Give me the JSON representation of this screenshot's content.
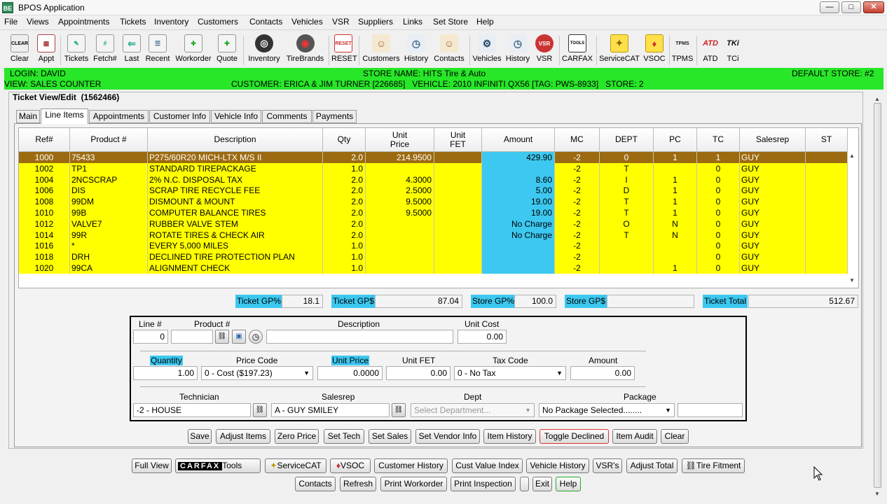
{
  "window": {
    "title": "BPOS Application",
    "icon": "BE",
    "controls": [
      "—",
      "□",
      "✕"
    ]
  },
  "menu": [
    "File",
    "Views",
    "Appointments",
    "Tickets",
    "Inventory",
    "Customers",
    "Contacts",
    "Vehicles",
    "VSR",
    "Suppliers",
    "Links",
    "Set Store",
    "Help"
  ],
  "toolbar": [
    {
      "label": "Clear",
      "icon": "CLEAR"
    },
    {
      "label": "Appt",
      "icon": "▦"
    },
    {
      "label": "Tickets",
      "icon": "✎"
    },
    {
      "label": "Fetch#",
      "icon": "#"
    },
    {
      "label": "Last",
      "icon": "⇐"
    },
    {
      "label": "Recent",
      "icon": "☰"
    },
    {
      "label": "Workorder",
      "icon": "✚"
    },
    {
      "label": "Quote",
      "icon": "✚"
    },
    {
      "label": "Inventory",
      "icon": "◎"
    },
    {
      "label": "TireBrands",
      "icon": "◉"
    },
    {
      "label": "RESET",
      "icon": "RESET"
    },
    {
      "label": "Customers",
      "icon": "☺"
    },
    {
      "label": "History",
      "icon": "◷"
    },
    {
      "label": "Contacts",
      "icon": "☺"
    },
    {
      "label": "Vehicles",
      "icon": "⚙"
    },
    {
      "label": "History",
      "icon": "◷"
    },
    {
      "label": "VSR",
      "icon": "VSR"
    },
    {
      "label": "CARFAX",
      "icon": "TOOLS"
    },
    {
      "label": "ServiceCAT",
      "icon": "✦"
    },
    {
      "label": "VSOC",
      "icon": "♦"
    },
    {
      "label": "TPMS",
      "icon": "TPMS"
    },
    {
      "label": "ATD",
      "icon": "ATD"
    },
    {
      "label": "TCi",
      "icon": "TKi"
    }
  ],
  "info": {
    "login": "LOGIN: DAVID",
    "view": "VIEW: SALES COUNTER",
    "store_name": "STORE NAME: HITS Tire & Auto",
    "customer_line": "CUSTOMER: ERICA & JIM TURNER [226685]   VEHICLE: 2010 INFINITI QX56 [TAG: PWS-8933]   STORE: 2",
    "default_store": "DEFAULT STORE: #2"
  },
  "panel": {
    "title": "Ticket View/Edit  (1562466)"
  },
  "tabs": [
    "Main",
    "Line Items",
    "Appointments",
    "Customer Info",
    "Vehicle Info",
    "Comments",
    "Payments"
  ],
  "grid": {
    "headers": [
      "Ref#",
      "Product #",
      "Description",
      "Qty",
      "Unit\nPrice",
      "Unit\nFET",
      "Amount",
      "MC",
      "DEPT",
      "PC",
      "TC",
      "Salesrep",
      "ST"
    ],
    "rows": [
      [
        "1000",
        "75433",
        "P275/60R20  MICH-LTX M/S II",
        "2.0",
        "214.9500",
        "",
        "429.90",
        "-2",
        "0",
        "1",
        "1",
        "GUY",
        ""
      ],
      [
        "1002",
        "TP1",
        "STANDARD TIREPACKAGE",
        "1.0",
        "",
        "",
        "",
        "-2",
        "T",
        "",
        "0",
        "GUY",
        ""
      ],
      [
        "1004",
        "2NCSCRAP",
        "2% N.C. DISPOSAL TAX",
        "2.0",
        "4.3000",
        "",
        "8.60",
        "-2",
        "I",
        "1",
        "0",
        "GUY",
        ""
      ],
      [
        "1006",
        "DIS",
        "SCRAP TIRE RECYCLE FEE",
        "2.0",
        "2.5000",
        "",
        "5.00",
        "-2",
        "D",
        "1",
        "0",
        "GUY",
        ""
      ],
      [
        "1008",
        "99DM",
        "DISMOUNT & MOUNT",
        "2.0",
        "9.5000",
        "",
        "19.00",
        "-2",
        "T",
        "1",
        "0",
        "GUY",
        ""
      ],
      [
        "1010",
        "99B",
        "COMPUTER BALANCE TIRES",
        "2.0",
        "9.5000",
        "",
        "19.00",
        "-2",
        "T",
        "1",
        "0",
        "GUY",
        ""
      ],
      [
        "1012",
        "VALVE7",
        "RUBBER VALVE STEM",
        "2.0",
        "",
        "",
        "No Charge",
        "-2",
        "O",
        "N",
        "0",
        "GUY",
        ""
      ],
      [
        "1014",
        "99R",
        "ROTATE TIRES & CHECK AIR",
        "2.0",
        "",
        "",
        "No Charge",
        "-2",
        "T",
        "N",
        "0",
        "GUY",
        ""
      ],
      [
        "1016",
        "*",
        "EVERY 5,000  MILES",
        "1.0",
        "",
        "",
        "",
        "-2",
        "",
        "",
        "0",
        "GUY",
        ""
      ],
      [
        "1018",
        "DRH",
        "DECLINED TIRE PROTECTION PLAN",
        "1.0",
        "",
        "",
        "",
        "-2",
        "",
        "",
        "0",
        "GUY",
        ""
      ],
      [
        "1020",
        "99CA",
        "ALIGNMENT CHECK",
        "1.0",
        "",
        "",
        "",
        "-2",
        "",
        "1",
        "0",
        "GUY",
        ""
      ]
    ]
  },
  "totals": {
    "ticket_gp_pct_label": "Ticket GP%",
    "ticket_gp_pct": "18.1",
    "ticket_gp_label": "Ticket GP$",
    "ticket_gp": "87.04",
    "store_gp_pct_label": "Store GP%",
    "store_gp_pct": "100.0",
    "store_gp_label": "Store GP$",
    "store_gp": "",
    "ticket_total_label": "Ticket Total",
    "ticket_total": "512.67"
  },
  "editor": {
    "line_label": "Line #",
    "line_value": "0",
    "product_label": "Product #",
    "product_value": "",
    "description_label": "Description",
    "description_value": "",
    "unit_cost_label": "Unit Cost",
    "unit_cost_value": "0.00",
    "quantity_label": "Quantity",
    "quantity_value": "1.00",
    "price_code_label": "Price Code",
    "price_code_value": "0 - Cost ($197.23)",
    "unit_price_label": "Unit Price",
    "unit_price_value": "0.0000",
    "unit_fet_label": "Unit FET",
    "unit_fet_value": "0.00",
    "tax_code_label": "Tax Code",
    "tax_code_value": "0 - No Tax",
    "amount_label": "Amount",
    "amount_value": "0.00",
    "technician_label": "Technician",
    "technician_value": "-2 -  HOUSE",
    "salesrep_label": "Salesrep",
    "salesrep_value": "A - GUY SMILEY",
    "dept_label": "Dept",
    "dept_placeholder": "Select Department...",
    "package_label": "Package",
    "package_value": "No Package Selected........",
    "package_extra": ""
  },
  "actions": [
    "Save",
    "Adjust Items",
    "Zero Price",
    "Set Tech",
    "Set Sales",
    "Set Vendor Info",
    "Item History",
    "Toggle Declined",
    "Item Audit",
    "Clear"
  ],
  "bottom_row1": [
    "Full View",
    "CARFAX",
    "ServiceCAT",
    "VSOC",
    "Customer History",
    "Cust Value Index",
    "Vehicle History",
    "VSR's",
    "Adjust Total",
    "Tire Fitment"
  ],
  "carfax_tools_label": "Tools",
  "bottom_row2": [
    "Contacts",
    "Refresh",
    "Print Workorder",
    "Print Inspection",
    "",
    "Exit",
    "Help"
  ],
  "colors": {
    "info_bar": "#28e628",
    "row": "#ffff00",
    "selected": "#9c6a10",
    "amount": "#3cc8f0"
  }
}
